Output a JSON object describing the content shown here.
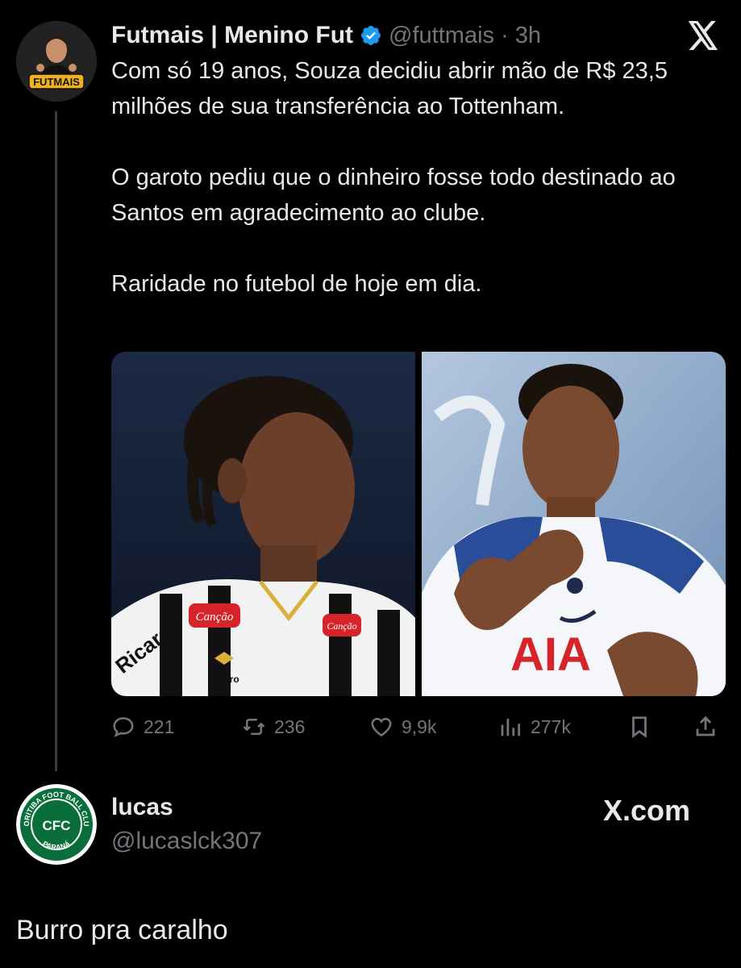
{
  "original_tweet": {
    "author_name": "Futmais | Menino Fut",
    "handle_time": "@futtmais · 3h",
    "avatar_badge": "FUTMAIS",
    "paragraphs": [
      "Com só 19 anos, Souza decidiu abrir mão de R$ 23,5 milhões de sua transferência ao Tottenham.",
      "O garoto pediu que o dinheiro fosse todo destinado ao Santos em agradecimento ao clube.",
      "Raridade no futebol de hoje em dia."
    ],
    "media": {
      "left_shirt_texts": [
        "Ricardo",
        "Canção",
        "Canção",
        "umbro"
      ],
      "right_shirt_texts": [
        "AIA"
      ]
    },
    "actions": {
      "replies": "221",
      "reposts": "236",
      "likes": "9,9k",
      "views": "277k"
    }
  },
  "reply": {
    "author_name": "lucas",
    "handle": "@lucaslck307",
    "avatar_text_top": "CORITIBA FOOT BALL CLUB",
    "avatar_text_mid": "CFC",
    "avatar_text_bottom": "PARANÁ",
    "text": "Burro pra caralho",
    "source_label": "X.com"
  },
  "colors": {
    "background": "#000000",
    "primary_text": "#e7e9ea",
    "secondary_text": "#71767b",
    "verified_blue": "#1d9bf0",
    "coritiba_green": "#0a6e3a"
  }
}
